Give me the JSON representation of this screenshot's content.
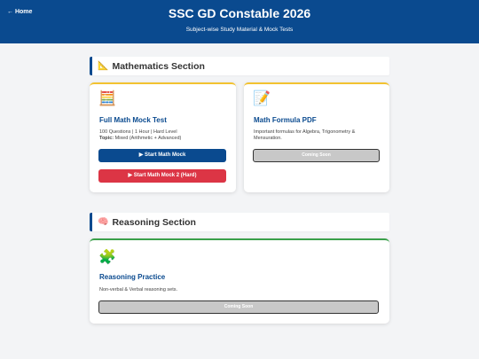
{
  "header": {
    "home_link": "← Home",
    "title": "SSC GD Constable 2026",
    "subtitle": "Subject-wise Study Material & Mock Tests"
  },
  "sections": {
    "math": {
      "icon": "📐",
      "title": "Mathematics Section",
      "cards": {
        "mock": {
          "icon": "🧮",
          "title": "Full Math Mock Test",
          "line1": "100 Questions | 1 Hour | Hard Level",
          "topic_label": "Topic:",
          "topic_value": " Mixed (Arithmetic + Advanced)",
          "btn_primary": "▶ Start Math Mock",
          "btn_secondary": "▶ Start Math Mock 2 (Hard)"
        },
        "pdf": {
          "icon": "📝",
          "title": "Math Formula PDF",
          "desc": "Important formulas for Algebra, Trigonometry & Mensuration.",
          "btn": "Coming Soon"
        }
      }
    },
    "reasoning": {
      "icon": "🧠",
      "title": "Reasoning Section",
      "cards": {
        "practice": {
          "icon": "🧩",
          "title": "Reasoning Practice",
          "desc": "Non-verbal & Verbal reasoning sets.",
          "btn": "Coming Soon"
        }
      }
    }
  },
  "colors": {
    "header": "#0a4a8f",
    "accent_yellow": "#f2c230",
    "accent_green": "#3aa04a",
    "danger": "#dc3545",
    "disabled": "#c8c8c8"
  }
}
